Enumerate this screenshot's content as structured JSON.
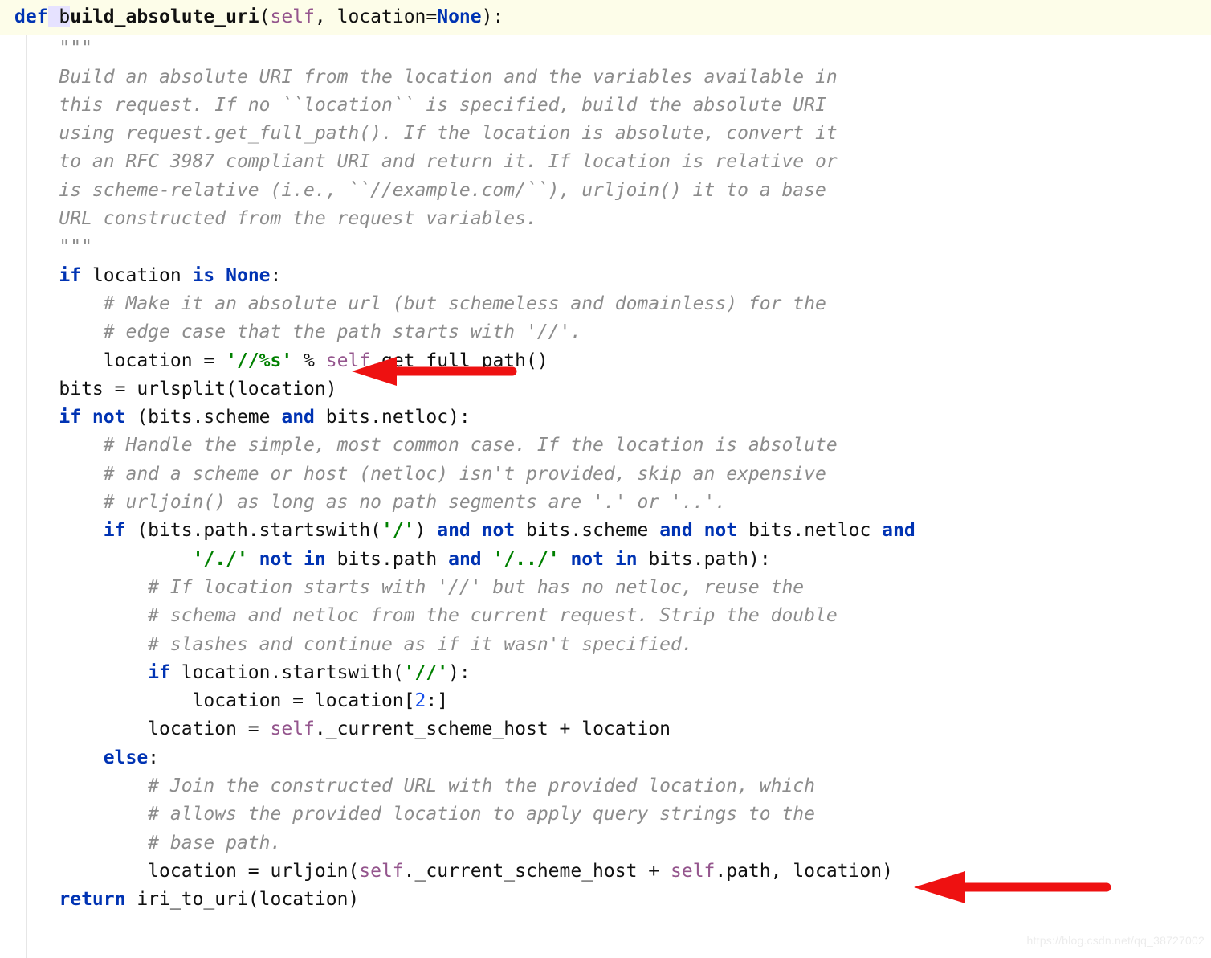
{
  "signature": {
    "def": "def",
    "hl_prefix": " b",
    "fname_rest": "uild_absolute_uri",
    "open": "(",
    "self": "self",
    "comma": ", ",
    "kwarg": "location=",
    "none": "None",
    "close": "):"
  },
  "L1": "    \"\"\"",
  "L2": "    Build an absolute URI from the location and the variables available in",
  "L3": "    this request. If no ``location`` is specified, build the absolute URI",
  "L4": "    using request.get_full_path(). If the location is absolute, convert it",
  "L5": "    to an RFC 3987 compliant URI and return it. If location is relative or",
  "L6": "    is scheme-relative (i.e., ``//example.com/``), urljoin() it to a base",
  "L7": "    URL constructed from the request variables.",
  "L8": "    \"\"\"",
  "L9a": "    ",
  "L9b": "if",
  "L9c": " location ",
  "L9d": "is",
  "L9e": " ",
  "L9f": "None",
  "L9g": ":",
  "L10": "        # Make it an absolute url (but schemeless and domainless) for the",
  "L11": "        # edge case that the path starts with '//'.",
  "L12a": "        location = ",
  "L12b": "'//%s'",
  "L12c": " % ",
  "L12d": "self",
  "L12e": ".get_full_path()",
  "L13": "    bits = urlsplit(location)",
  "L14a": "    ",
  "L14b": "if not",
  "L14c": " (bits.scheme ",
  "L14d": "and",
  "L14e": " bits.netloc):",
  "L15": "        # Handle the simple, most common case. If the location is absolute",
  "L16": "        # and a scheme or host (netloc) isn't provided, skip an expensive",
  "L17": "        # urljoin() as long as no path segments are '.' or '..'.",
  "L18a": "        ",
  "L18b": "if",
  "L18c": " (bits.path.startswith(",
  "L18d": "'/'",
  "L18e": ") ",
  "L18f": "and not",
  "L18g": " bits.scheme ",
  "L18h": "and not",
  "L18i": " bits.netloc ",
  "L18j": "and",
  "L19a": "                ",
  "L19b": "'/./'",
  "L19c": " ",
  "L19d": "not in",
  "L19e": " bits.path ",
  "L19f": "and",
  "L19g": " ",
  "L19h": "'/../'",
  "L19i": " ",
  "L19j": "not in",
  "L19k": " bits.path):",
  "L20": "            # If location starts with '//' but has no netloc, reuse the",
  "L21": "            # schema and netloc from the current request. Strip the double",
  "L22": "            # slashes and continue as if it wasn't specified.",
  "L23a": "            ",
  "L23b": "if",
  "L23c": " location.startswith(",
  "L23d": "'//'",
  "L23e": "):",
  "L24a": "                location = location[",
  "L24b": "2",
  "L24c": ":]",
  "L25a": "            location = ",
  "L25b": "self",
  "L25c": "._current_scheme_host + location",
  "L26a": "        ",
  "L26b": "else",
  "L26c": ":",
  "L27": "            # Join the constructed URL with the provided location, which",
  "L28": "            # allows the provided location to apply query strings to the",
  "L29": "            # base path.",
  "L30a": "            location = urljoin(",
  "L30b": "self",
  "L30c": "._current_scheme_host + ",
  "L30d": "self",
  "L30e": ".path, location)",
  "L31a": "    ",
  "L31b": "return",
  "L31c": " iri_to_uri(location)",
  "watermark": "https://blog.csdn.net/qq_38727002"
}
